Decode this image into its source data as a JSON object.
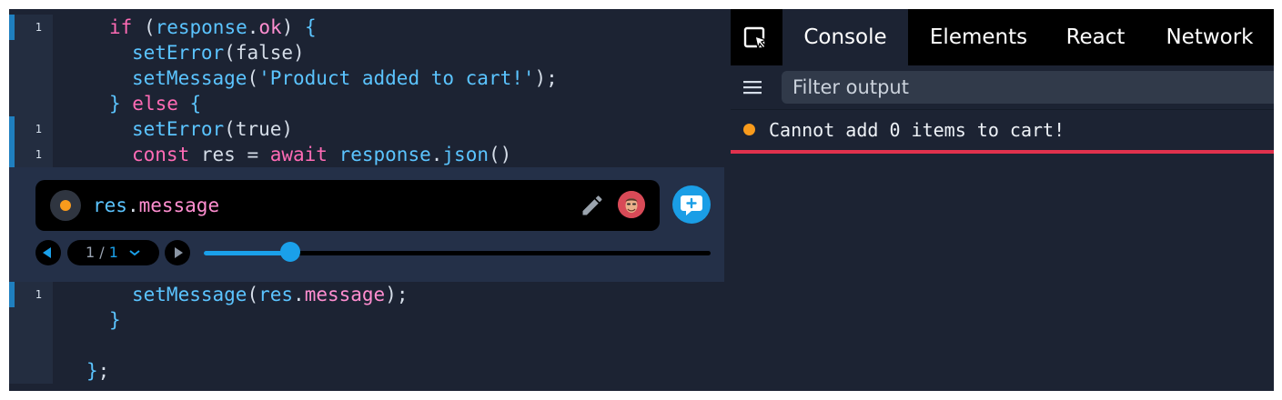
{
  "editor": {
    "lines_top": [
      {
        "hits": "1",
        "parts": [
          [
            "kw",
            "if "
          ],
          [
            "pun",
            "("
          ],
          [
            "fn",
            "response"
          ],
          [
            "pun",
            "."
          ],
          [
            "prop",
            "ok"
          ],
          [
            "pun",
            ") "
          ],
          [
            "brk",
            "{"
          ]
        ]
      },
      {
        "hits": "",
        "parts": [
          [
            "fn",
            "setError"
          ],
          [
            "pun",
            "("
          ],
          [
            "var",
            "false"
          ],
          [
            "pun",
            ")"
          ]
        ]
      },
      {
        "hits": "",
        "parts": [
          [
            "fn",
            "setMessage"
          ],
          [
            "pun",
            "("
          ],
          [
            "str",
            "'Product added to cart!'"
          ],
          [
            "pun",
            ");"
          ]
        ]
      },
      {
        "hits": "",
        "parts": [
          [
            "brk",
            "} "
          ],
          [
            "kw",
            "else "
          ],
          [
            "brk",
            "{"
          ]
        ]
      },
      {
        "hits": "1",
        "parts": [
          [
            "fn",
            "setError"
          ],
          [
            "pun",
            "("
          ],
          [
            "var",
            "true"
          ],
          [
            "pun",
            ")"
          ]
        ]
      },
      {
        "hits": "1",
        "parts": [
          [
            "kw",
            "const "
          ],
          [
            "var",
            "res "
          ],
          [
            "pun",
            "= "
          ],
          [
            "kw",
            "await "
          ],
          [
            "fn",
            "response"
          ],
          [
            "pun",
            "."
          ],
          [
            "fn",
            "json"
          ],
          [
            "pun",
            "()"
          ]
        ]
      }
    ],
    "lines_bottom": [
      {
        "hits": "1",
        "parts": [
          [
            "fn",
            "setMessage"
          ],
          [
            "pun",
            "("
          ],
          [
            "fn",
            "res"
          ],
          [
            "pun",
            "."
          ],
          [
            "prop",
            "message"
          ],
          [
            "pun",
            ");"
          ]
        ]
      },
      {
        "hits": "",
        "parts": [
          [
            "brk",
            "}"
          ]
        ]
      },
      {
        "hits": "",
        "parts": []
      },
      {
        "hits": "",
        "parts": [
          [
            "brk",
            "}"
          ],
          [
            "pun",
            ";"
          ]
        ]
      }
    ],
    "logpoint": {
      "expr_obj": "res",
      "expr_dot": ".",
      "expr_prop": "message",
      "counter_current": "1",
      "counter_sep": " / ",
      "counter_total": "1",
      "progress": 0.17
    }
  },
  "devtools": {
    "tabs": [
      {
        "label": "Console",
        "active": true
      },
      {
        "label": "Elements",
        "active": false
      },
      {
        "label": "React",
        "active": false
      },
      {
        "label": "Network",
        "active": false
      }
    ],
    "filter_placeholder": "Filter output",
    "messages": [
      "Cannot add 0 items to cart!"
    ]
  },
  "colors": {
    "accent": "#1aa0ea",
    "warning_dot": "#f99b1c",
    "error_underline": "#e0314d"
  },
  "icons": [
    "cursor-select-icon",
    "menu-icon",
    "pencil-icon",
    "add-comment-icon",
    "triangle-left-icon",
    "triangle-right-icon",
    "chevron-down-icon"
  ]
}
